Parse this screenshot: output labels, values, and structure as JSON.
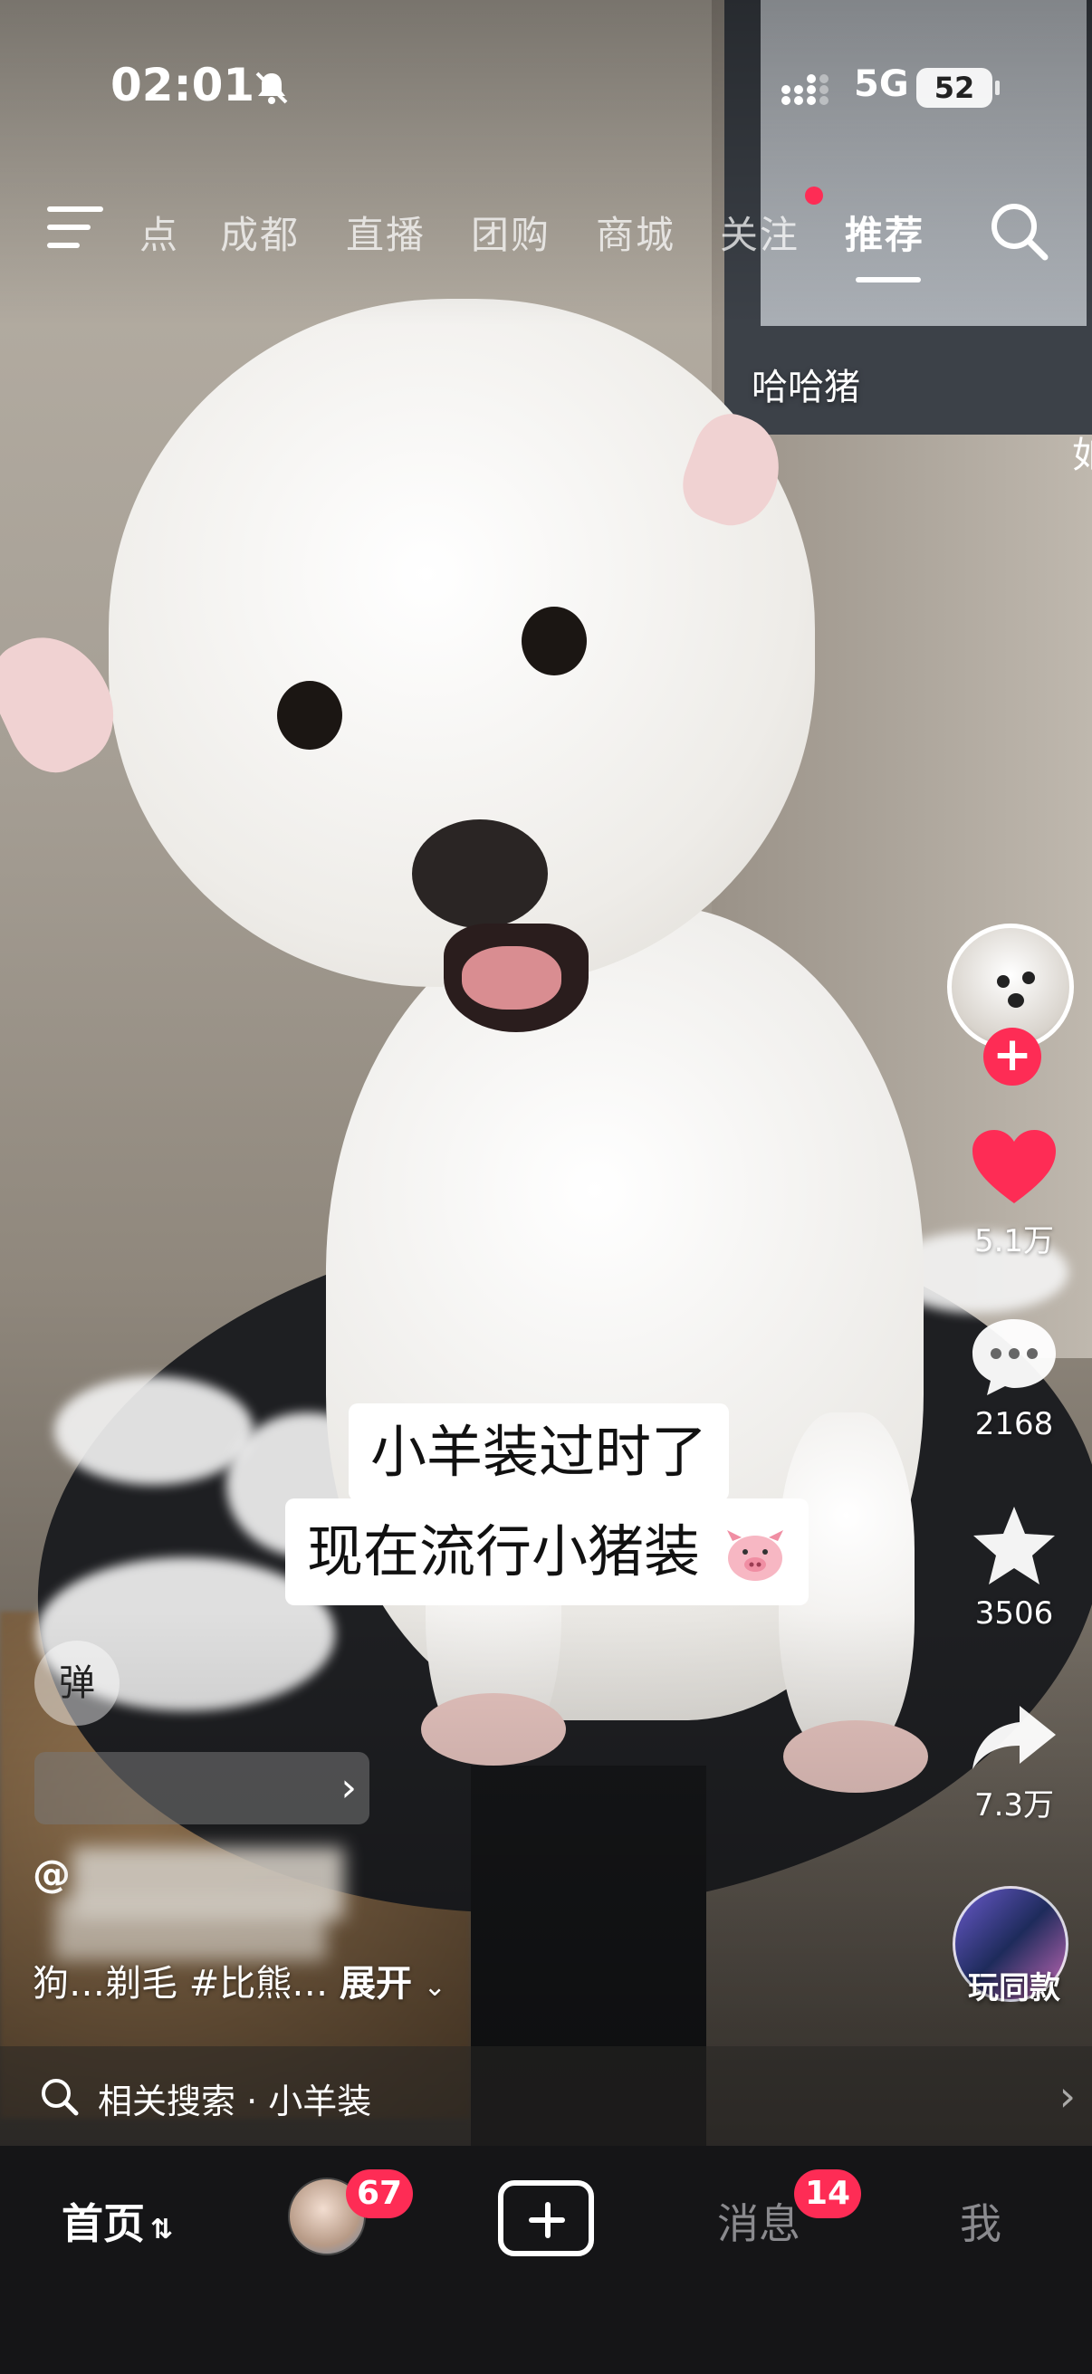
{
  "status_bar": {
    "time": "02:01",
    "network": "5G",
    "battery": "52"
  },
  "top_nav": {
    "tabs": [
      "点",
      "成都",
      "直播",
      "团购",
      "商城",
      "关注",
      "推荐"
    ],
    "active_tab": "推荐"
  },
  "video": {
    "location_tag": "哈哈猪",
    "edge_tag": "如",
    "caption_line1": "小羊装过时了",
    "caption_line2": "现在流行小猪装"
  },
  "right_rail": {
    "likes": "5.1万",
    "comments": "2168",
    "favorites": "3506",
    "shares": "7.3万",
    "same_style": "玩同款"
  },
  "overlay": {
    "danmu_label": "弹",
    "author_prefix": "@",
    "description_visible": "狗…剃毛 #比熊…",
    "expand_label": "展开",
    "related_search": "相关搜索 · 小羊装"
  },
  "tab_bar": {
    "home": "首页",
    "friends_badge": "67",
    "messages": "消息",
    "messages_badge": "14",
    "me": "我"
  },
  "colors": {
    "accent_red": "#fe2c55",
    "tabbar_bg": "#151517"
  }
}
